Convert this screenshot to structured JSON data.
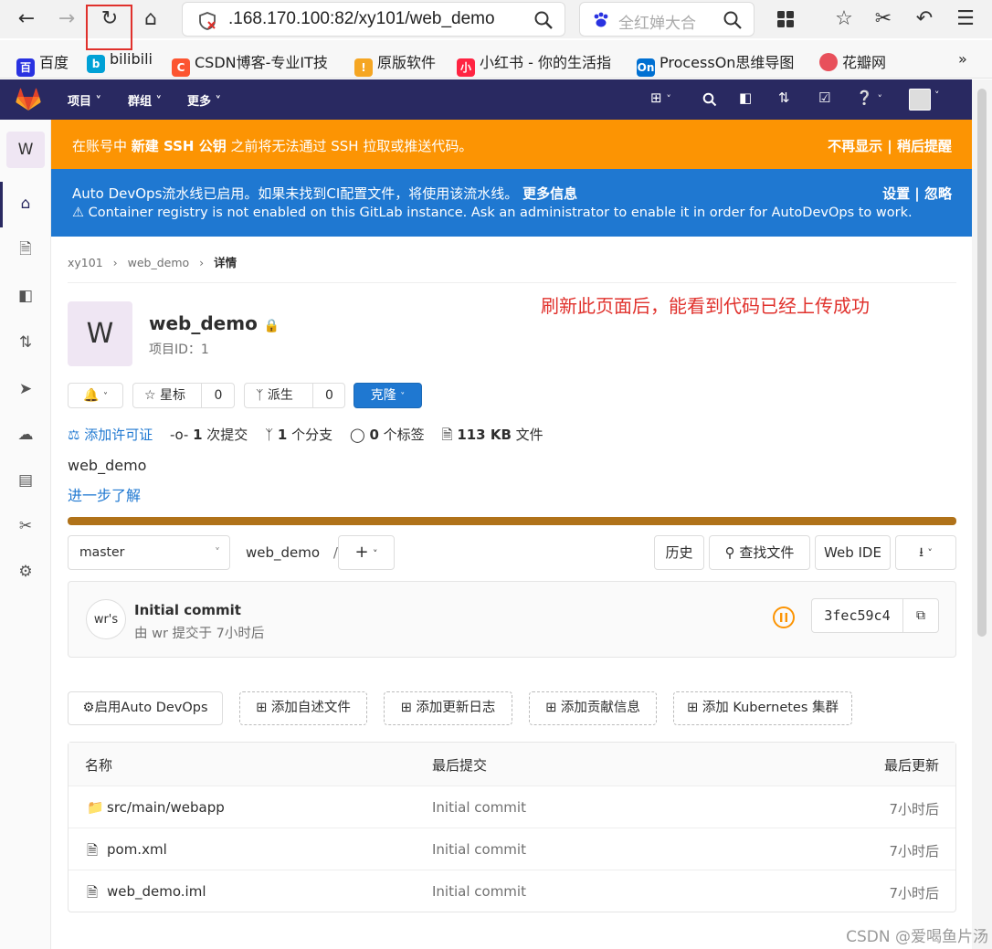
{
  "browser": {
    "url": ".168.170.100:82/xy101/web_demo",
    "search_placeholder": "全红婵大合",
    "bookmarks": [
      {
        "label": "百度",
        "icon": "baidu-icon",
        "color": "#2932e1"
      },
      {
        "label": "bilibili",
        "icon": "bilibili-icon",
        "color": "#00a1d6"
      },
      {
        "label": "CSDN博客-专业IT技",
        "icon": "csdn-icon",
        "color": "#fc5531"
      },
      {
        "label": "原版软件",
        "icon": "software-icon",
        "color": "#f5a623"
      },
      {
        "label": "小红书 - 你的生活指",
        "icon": "xiaohongshu-icon",
        "color": "#ff2442"
      },
      {
        "label": "ProcessOn思维导图",
        "icon": "processon-icon",
        "color": "#0070d2"
      },
      {
        "label": "花瓣网",
        "icon": "huaban-icon",
        "color": "#e8505b"
      }
    ],
    "more": "»"
  },
  "header": {
    "menu": [
      {
        "label": "项目"
      },
      {
        "label": "群组"
      },
      {
        "label": "更多"
      }
    ],
    "bg_color": "#292961"
  },
  "sidebar": {
    "avatar_letter": "W"
  },
  "banners": {
    "ssh": {
      "text_prefix": "在账号中 ",
      "text_bold": "新建 SSH 公钥",
      "text_suffix": " 之前将无法通过 SSH 拉取或推送代码。",
      "actions": "不再显示 | 稍后提醒",
      "color": "#fc9403"
    },
    "devops": {
      "line1": "Auto DevOps流水线已启用。如果未找到CI配置文件，将使用该流水线。",
      "more_info": "更多信息",
      "line2": "Container registry is not enabled on this GitLab instance. Ask an administrator to enable it in order for AutoDevOps to work.",
      "actions": "设置 | 忽略",
      "color": "#1f78d1"
    }
  },
  "breadcrumb": {
    "items": [
      "xy101",
      "web_demo",
      "详情"
    ]
  },
  "annotation": "刷新此页面后，能看到代码已经上传成功",
  "project": {
    "avatar_letter": "W",
    "name": "web_demo",
    "id_label": "项目ID：1",
    "star_label": "星标",
    "star_count": "0",
    "fork_label": "派生",
    "fork_count": "0",
    "clone_label": "克隆",
    "stats": {
      "license": "添加许可证",
      "commits_num": "1",
      "commits_label": " 次提交",
      "branches_num": "1",
      "branches_label": " 个分支",
      "tags_num": "0",
      "tags_label": " 个标签",
      "size_num": "113 KB",
      "size_label": " 文件"
    },
    "description": "web_demo",
    "learn_more": "进一步了解"
  },
  "repo": {
    "branch": "master",
    "path": "web_demo",
    "slash": "/",
    "history": "历史",
    "find_file": "查找文件",
    "web_ide": "Web IDE"
  },
  "commit": {
    "avatar_alt": "wr's",
    "title": "Initial commit",
    "meta": "由 wr 提交于 7小时后",
    "sha": "3fec59c4"
  },
  "actions": {
    "enable_devops": "启用Auto DevOps",
    "add_readme": "添加自述文件",
    "add_changelog": "添加更新日志",
    "add_contributing": "添加贡献信息",
    "add_k8s": "添加 Kubernetes 集群"
  },
  "files": {
    "headers": {
      "name": "名称",
      "last_commit": "最后提交",
      "last_update": "最后更新"
    },
    "rows": [
      {
        "name": "src/main/webapp",
        "commit": "Initial commit",
        "updated": "7小时后",
        "type": "folder"
      },
      {
        "name": "pom.xml",
        "commit": "Initial commit",
        "updated": "7小时后",
        "type": "file"
      },
      {
        "name": "web_demo.iml",
        "commit": "Initial commit",
        "updated": "7小时后",
        "type": "file"
      }
    ]
  },
  "watermark": "CSDN @爱喝鱼片汤"
}
